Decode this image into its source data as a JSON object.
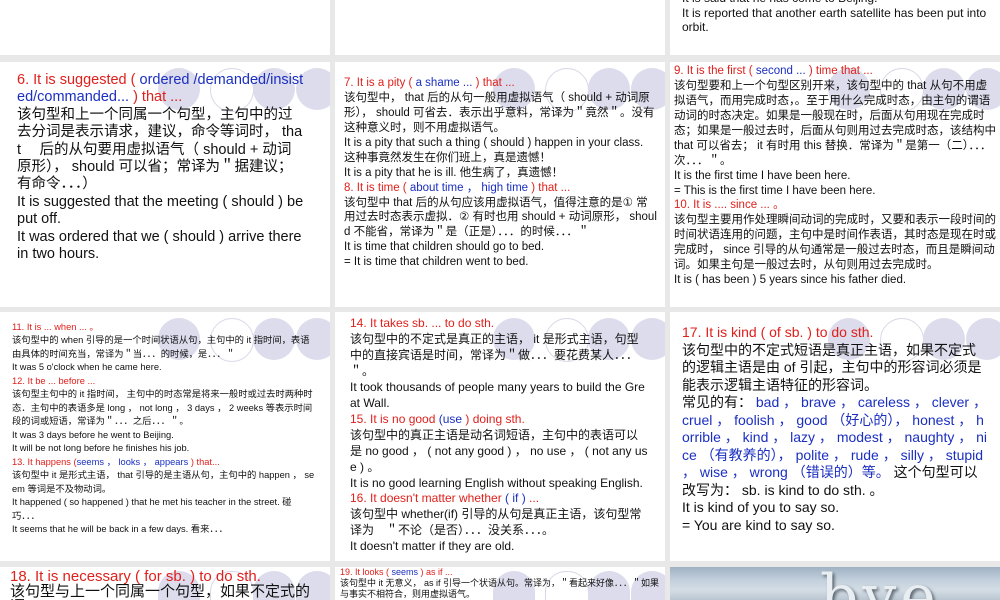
{
  "slides": [
    {
      "id": "s5",
      "paras": [
        [
          {
            "t": "It is said that he has come to Beijing.",
            "c": "k"
          }
        ],
        [
          {
            "t": "It is reported that another earth satellite has been put into orbit.",
            "c": "k"
          }
        ]
      ]
    },
    {
      "id": "s6",
      "paras": [
        [
          {
            "t": "6. It is suggested ( ",
            "c": "r"
          },
          {
            "t": "ordered /demanded/insisted/commanded... ",
            "c": "b"
          },
          {
            "t": ") that ...",
            "c": "r"
          }
        ],
        [
          {
            "t": "该句型和上一个同属一个句型，主句中的过去分词是表示请求，建议，命令等词时， that 　后的从句要用虚拟语气（ should + 动词原形）， should 可以省；常译为＂据建议；有命令．．．）",
            "c": "k"
          }
        ],
        [
          {
            "t": "It is suggested that the meeting ( should ) be put off.",
            "c": "k"
          }
        ],
        [
          {
            "t": "It was ordered that we ( should ) arrive there in two hours.",
            "c": "k"
          }
        ]
      ]
    },
    {
      "id": "s7",
      "paras": [
        [
          {
            "t": "7. It is a pity ( ",
            "c": "r"
          },
          {
            "t": "a shame ... ",
            "c": "b"
          },
          {
            "t": ") that ...",
            "c": "r"
          }
        ],
        [
          {
            "t": "该句型中， that 后的从句一般用虚拟语气（ should + 动词原形）， should 可省去．表示出乎意料，常译为＂竟然＂。没有这种意义时，则不用虚拟语气。",
            "c": "k"
          }
        ],
        [
          {
            "t": "It is a pity that such a thing ( should ) happen in your class.",
            "c": "k"
          }
        ],
        [
          {
            "t": "这种事竟然发生在你们班上，真是遗憾！",
            "c": "k"
          }
        ],
        [
          {
            "t": "It is a pity that he is ill.  他生病了，真遗憾！",
            "c": "k"
          }
        ],
        [
          {
            "t": "8. It is time ( ",
            "c": "r"
          },
          {
            "t": "about time ，  high time ",
            "c": "b"
          },
          {
            "t": ") that ...",
            "c": "r"
          }
        ],
        [
          {
            "t": "该句型中 that 后的从句应该用虚拟语气，值得注意的是①  常用过去时态表示虚拟．②  有时也用 should +  动词原形， should  不能省，常译为＂是（正是）．．．的时候．．．＂",
            "c": "k"
          }
        ],
        [
          {
            "t": "It is time that children should go to bed.",
            "c": "k"
          }
        ],
        [
          {
            "t": "= It is time that children went to bed.",
            "c": "k"
          }
        ]
      ]
    },
    {
      "id": "s9",
      "paras": [
        [
          {
            "t": "9. It is the first ( ",
            "c": "r"
          },
          {
            "t": "second ... ",
            "c": "b"
          },
          {
            "t": ") time that ...",
            "c": "r"
          }
        ],
        [
          {
            "t": "该句型要和上一个句型区别开来，该句型中的  that 从句不用虚拟语气，而用完成时态，。至于用什么完成时态，由主句的谓语动词的时态决定。如果是一般现在时，后面从句用现在完成时态；如果是一般过去时，后面从句则用过去完成时态，该结构中  that 可以省去； it 有时用  this 替换．常译为＂是第一（二）．．．次．．．＂。",
            "c": "k"
          }
        ],
        [
          {
            "t": "It is the first time I have been here.",
            "c": "k"
          }
        ],
        [
          {
            "t": "= This is the first time I have been here.",
            "c": "k"
          }
        ],
        [
          {
            "t": "10. It is .... since ... 。",
            "c": "r"
          }
        ],
        [
          {
            "t": "该句型主要用作处理瞬间动词的完成时，又要和表示一段时间的时间状语连用的问题，主句中是时间作表语，其时态是现在时或完成时， since  引导的从句通常是一般过去时态，而且是瞬间动词。如果主句是一般过去时，从句则用过去完成时。",
            "c": "k"
          }
        ],
        [
          {
            "t": "It is ( has been ) 5 years since his father died.",
            "c": "k"
          }
        ]
      ]
    },
    {
      "id": "s11",
      "paras": [
        [
          {
            "t": "11. It is ... when ... 。",
            "c": "r"
          }
        ],
        [
          {
            "t": "该句型中的  when  引导的是一个时间状语从句，主句中的  it 指时间，表语由具体的时间充当，常译为＂当．．．的时候，是．．．＂",
            "c": "k"
          }
        ],
        [
          {
            "t": "It was 5 o'clock when he came here.",
            "c": "k"
          }
        ],
        [
          {
            "t": "12. It be ... before ...",
            "c": "r"
          }
        ],
        [
          {
            "t": "该句型主句中的  it  指时间，  主句中的时态常是将来一般时或过去时两种时态．主句中的表语多是 long ，  not long ，  3 days ，  2 weeks  等表示时间段的词或短语，常译为＂．．．之后．．．＂。",
            "c": "k"
          }
        ],
        [
          {
            "t": "It was 3 days before he went to Beijing.",
            "c": "k"
          }
        ],
        [
          {
            "t": "It will be not long before he finishes his job.",
            "c": "k"
          }
        ],
        [
          {
            "t": "13. It happens (",
            "c": "r"
          },
          {
            "t": "seems ，   looks ，   appears ",
            "c": "b"
          },
          {
            "t": ") that...",
            "c": "r"
          }
        ],
        [
          {
            "t": "该句型中 it 是形式主语， that  引导的是主语从句，主句中的 happen ，   seem 等词是不及物动词。",
            "c": "k"
          }
        ],
        [
          {
            "t": "It happened ( so happened ) that he met his teacher in the street. 碰巧．．．",
            "c": "k"
          }
        ],
        [
          {
            "t": "It seems that he will be back in a few days.  看来．．．",
            "c": "k"
          }
        ]
      ]
    },
    {
      "id": "s14",
      "paras": [
        [
          {
            "t": "14. It takes sb. ... to do sth.",
            "c": "r"
          }
        ],
        [
          {
            "t": "该句型中的不定式是真正的主语， it 是形式主语，句型中的直接宾语是时间，常译为＂做．．．要花费某人．．．＂。",
            "c": "k"
          }
        ],
        [
          {
            "t": "It took thousands of people many years to build the Great Wall.",
            "c": "k"
          }
        ],
        [
          {
            "t": "15. It is no good ",
            "c": "r"
          },
          {
            "t": "(use ",
            "c": "b"
          },
          {
            "t": ") doing sth.",
            "c": "r"
          }
        ],
        [
          {
            "t": "该句型中的真正主语是动名词短语，主句中的表语可以是 no good ，  ( not any good ) ，   no use ，  ( not any use ) 。",
            "c": "k"
          }
        ],
        [
          {
            "t": "It is no good learning English without speaking English.",
            "c": "k"
          }
        ],
        [
          {
            "t": "16. It doesn't matter whether ",
            "c": "r"
          },
          {
            "t": "( if ) ",
            "c": "b"
          },
          {
            "t": "...",
            "c": "r"
          }
        ],
        [
          {
            "t": "该句型中 whether(if)  引导的从句是真正主语，该句型常译为　＂不论（是否）．．．没关系．．．。",
            "c": "k"
          }
        ],
        [
          {
            "t": "It doesn't matter if they are old.",
            "c": "k"
          }
        ]
      ]
    },
    {
      "id": "s17",
      "paras": [
        [
          {
            "t": "17. It is kind ( of sb. ) to do sth.",
            "c": "r"
          }
        ],
        [
          {
            "t": "该句型中的不定式短语是真正主语，如果不定式的逻辑主语是由   of 引起，主句中的形容词必须是能表示逻辑主语特征的形容词。",
            "c": "k"
          }
        ],
        [
          {
            "t": "常见的有：  ",
            "c": "k"
          },
          {
            "t": "bad ，  brave ，  careless ，  clever ，  cruel ，  foolish ，  good （好心的），  honest ，  horrible ，  kind ，  lazy ，  modest ，  naughty ，  nice （有教养的），  polite ，  rude ，  silly ，  stupid ，  wise ，  wrong （错误的）等。 ",
            "c": "b"
          },
          {
            "t": "这个句型可以改写为： sb. is kind to do sth. 。",
            "c": "k"
          }
        ],
        [
          {
            "t": "It is kind of you to say so.",
            "c": "k"
          }
        ],
        [
          {
            "t": "= You are kind to say so.",
            "c": "k"
          }
        ]
      ]
    },
    {
      "id": "s18",
      "paras": [
        [
          {
            "t": "18. It is necessary ( for sb. ) to do sth.",
            "c": "r"
          }
        ],
        [
          {
            "t": "该句型与上一个同属一个句型，如果不定式的逻",
            "c": "k"
          }
        ]
      ]
    },
    {
      "id": "s19",
      "paras": [
        [
          {
            "t": "19. It looks ( ",
            "c": "r"
          },
          {
            "t": "seems ",
            "c": "b"
          },
          {
            "t": ") as if ...",
            "c": "r"
          }
        ],
        [
          {
            "t": "该句型中 it 无意义，   as if  引导一个状语从句。常译为，＂看起来好像．．．＂如果与事实不相符合，则用虚拟语气。",
            "c": "k"
          }
        ]
      ]
    },
    {
      "id": "s20",
      "paras": [],
      "logo": "bye"
    }
  ]
}
